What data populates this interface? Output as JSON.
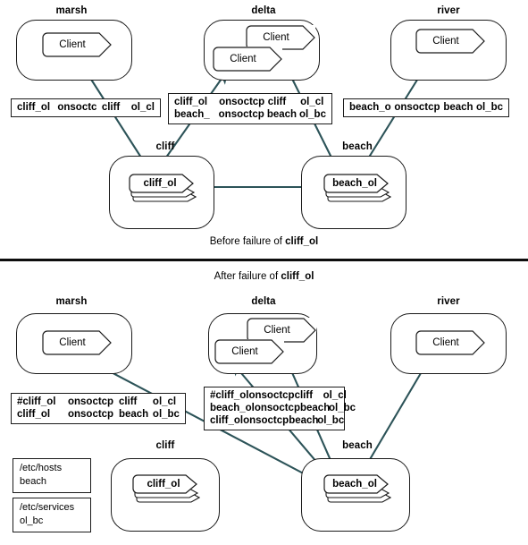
{
  "figure": {
    "caption_before": "Before failure of ",
    "caption_before_bold": "cliff_ol",
    "caption_after": "After failure of ",
    "caption_after_bold": "cliff_ol",
    "arrow_color": "#2c5358",
    "line_color": "#1a1a1a",
    "shadow_color": "#d8dad9"
  },
  "labels": {
    "client": "Client",
    "marsh": "marsh",
    "delta": "delta",
    "river": "river",
    "cliff": "cliff",
    "beach": "beach",
    "cliff_ol": "cliff_ol",
    "beach_ol": "beach_ol"
  },
  "before": {
    "marsh_map": {
      "rows": [
        {
          "c1": "cliff_ol",
          "c2": "onsoctc",
          "c3": "cliff",
          "c4": "ol_cl"
        }
      ]
    },
    "delta_map": {
      "rows": [
        {
          "c1": "cliff_ol",
          "c2": "onsoctcp",
          "c3": "cliff",
          "c4": "ol_cl"
        },
        {
          "c1": "beach_",
          "c2": "onsoctcp",
          "c3": "beach",
          "c4": "ol_bc"
        }
      ]
    },
    "river_map": {
      "rows": [
        {
          "c1": "beach_o",
          "c2": "onsoctcp",
          "c3": "beach",
          "c4": "ol_bc"
        }
      ]
    }
  },
  "after": {
    "marsh_map": {
      "rows": [
        {
          "c1": "#cliff_ol",
          "c2": "onsoctcp",
          "c3": "cliff",
          "c4": "ol_cl"
        },
        {
          "c1": "cliff_ol",
          "c2": "onsoctcp",
          "c3": "beach",
          "c4": "ol_bc"
        }
      ]
    },
    "delta_map": {
      "rows": [
        {
          "c1": "#cliff_ol",
          "c2": "onsoctcp",
          "c3": "cliff",
          "c4": "ol_cl"
        },
        {
          "c1": "beach_ol",
          "c2": "onsoctcp",
          "c3": "beach",
          "c4": "ol_bc"
        },
        {
          "c1": "cliff_ol",
          "c2": "onsoctcp",
          "c3": "beach",
          "c4": "ol_bc"
        }
      ]
    },
    "hosts_file": {
      "line1": "/etc/hosts",
      "line2": "beach"
    },
    "services_file": {
      "line1": "/etc/services",
      "line2": "ol_bc"
    }
  }
}
